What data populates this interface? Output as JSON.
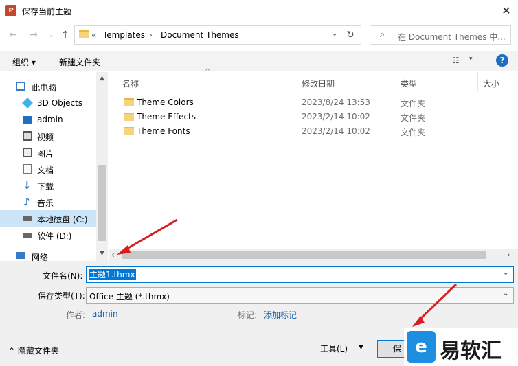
{
  "window": {
    "app_icon_text": "P",
    "title": "保存当前主题",
    "close": "✕"
  },
  "nav": {
    "back": "←",
    "forward": "→",
    "recent": "⌄",
    "up": "↑",
    "breadcrumb_prefix": "«",
    "breadcrumb": [
      "Templates",
      "Document Themes"
    ],
    "breadcrumb_sep": "›",
    "refresh": "↻",
    "search_placeholder": "在 Document Themes 中...",
    "search_icon": "⌕"
  },
  "toolbar": {
    "organize": "组织 ▾",
    "new_folder": "新建文件夹",
    "view_icon": "☷",
    "view_caret": "▾",
    "help": "?"
  },
  "sidebar": {
    "items": [
      {
        "label": "此电脑",
        "icon": "computer-icon",
        "color": "#3c78c8"
      },
      {
        "label": "3D Objects",
        "icon": "cube-icon",
        "color": "#3cb4e6"
      },
      {
        "label": "admin",
        "icon": "desktop-icon",
        "color": "#1e6fbf"
      },
      {
        "label": "视频",
        "icon": "video-icon",
        "color": "#555555"
      },
      {
        "label": "图片",
        "icon": "picture-icon",
        "color": "#555555"
      },
      {
        "label": "文档",
        "icon": "document-icon",
        "color": "#777777"
      },
      {
        "label": "下载",
        "icon": "download-icon",
        "color": "#1e6fbf"
      },
      {
        "label": "音乐",
        "icon": "music-icon",
        "color": "#1e6fbf"
      },
      {
        "label": "本地磁盘 (C:)",
        "icon": "drive-icon",
        "color": "#555555"
      },
      {
        "label": "软件 (D:)",
        "icon": "drive-icon",
        "color": "#555555"
      },
      {
        "label": "网络",
        "icon": "network-icon",
        "color": "#3c78c8"
      }
    ],
    "scroll_up": "▲",
    "scroll_down": "▼"
  },
  "files": {
    "columns": [
      "名称",
      "修改日期",
      "类型",
      "大小"
    ],
    "rows": [
      {
        "name": "Theme Colors",
        "date": "2023/8/24 13:53",
        "type": "文件夹"
      },
      {
        "name": "Theme Effects",
        "date": "2023/2/14 10:02",
        "type": "文件夹"
      },
      {
        "name": "Theme Fonts",
        "date": "2023/2/14 10:02",
        "type": "文件夹"
      }
    ],
    "sort_indicator": "^",
    "scroll_left": "‹",
    "scroll_right": "›"
  },
  "form": {
    "filename_label": "文件名(N):",
    "filename_value": "主题1.thmx",
    "filetype_label": "保存类型(T):",
    "filetype_value": "Office 主题 (*.thmx)",
    "dropdown_caret": "⌄",
    "author_label": "作者:",
    "author_value": "admin",
    "tags_label": "标记:",
    "tags_value": "添加标记"
  },
  "footer": {
    "hide_folders": "⌃ 隐藏文件夹",
    "tools": "工具(L)",
    "tools_caret": "▼",
    "save": "保"
  },
  "watermark": {
    "logo": "e",
    "text": "易软汇"
  },
  "colors": {
    "accent": "#0078d7",
    "selection": "#cce4f7",
    "annotation_arrow": "#d42020"
  }
}
